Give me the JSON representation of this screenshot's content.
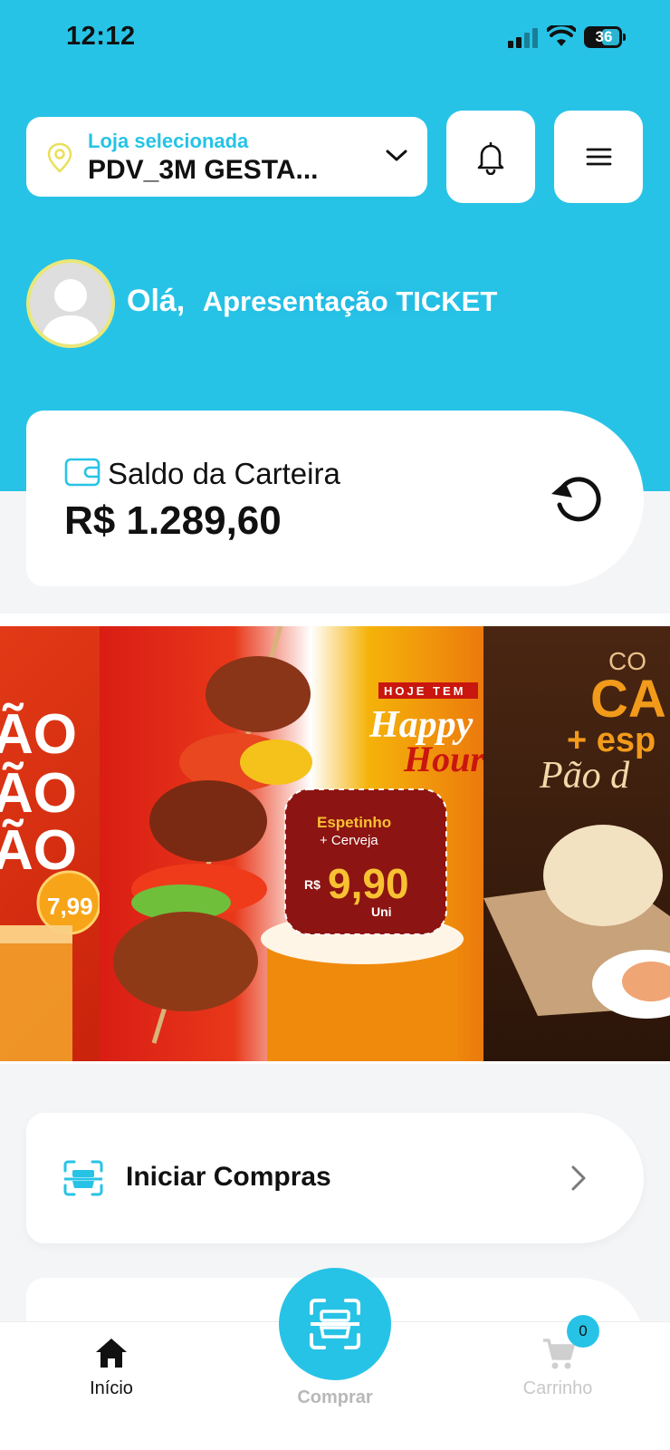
{
  "status_bar": {
    "time": "12:12",
    "battery": "36"
  },
  "header": {
    "store_label": "Loja selecionada",
    "store_value": "PDV_3M GESTA...",
    "greeting_prefix": "Olá,",
    "user_name": "Apresentação TICKET"
  },
  "wallet": {
    "label": "Saldo da Carteira",
    "balance": "R$ 1.289,60"
  },
  "banners": {
    "left": {
      "lines": [
        "ÃO",
        "ÃO",
        "ÃO"
      ],
      "price": "7,99"
    },
    "main": {
      "top_tag": "HOJE TEM",
      "headline1": "Happy",
      "headline2": "Hour",
      "promo_title": "Espetinho",
      "promo_sub": "+ Cerveja",
      "promo_currency": "R$",
      "promo_price": "9,90",
      "promo_unit": "Uni"
    },
    "right": {
      "line1": "CO",
      "line2": "CA",
      "line3": "+ esp",
      "line4": "Pão d"
    }
  },
  "actions": {
    "start_purchase": "Iniciar Compras"
  },
  "bottom_nav": {
    "home": "Início",
    "buy": "Comprar",
    "cart": "Carrinho",
    "cart_count": "0"
  },
  "colors": {
    "accent": "#27c3e6",
    "pin": "#e9e05a"
  }
}
